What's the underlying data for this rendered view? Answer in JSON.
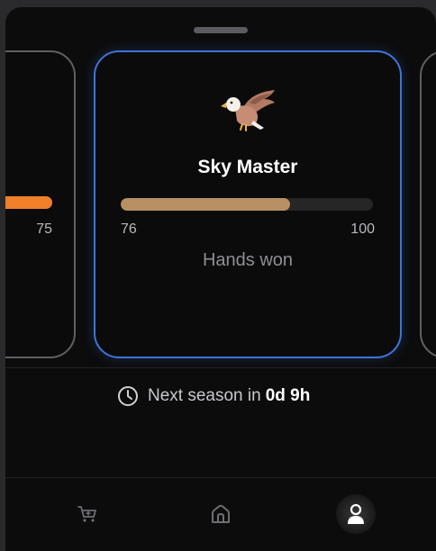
{
  "left_card": {
    "max_label": "75",
    "progress": 1.0,
    "bar_color": "#f07f2a"
  },
  "active_card": {
    "icon": "eagle-icon",
    "title": "Sky Master",
    "progress_min": "76",
    "progress_max": "100",
    "progress_fraction": 0.67,
    "metric_label": "Hands won",
    "bar_color": "#b88f62",
    "border_color": "#3f74d6"
  },
  "season": {
    "prefix": "Next season in",
    "remaining": "0d 9h",
    "icon": "clock-icon"
  },
  "nav": {
    "items": [
      {
        "name": "shop",
        "icon": "cart-icon",
        "active": false
      },
      {
        "name": "home",
        "icon": "home-icon",
        "active": false
      },
      {
        "name": "profile",
        "icon": "profile-icon",
        "active": true
      }
    ]
  }
}
